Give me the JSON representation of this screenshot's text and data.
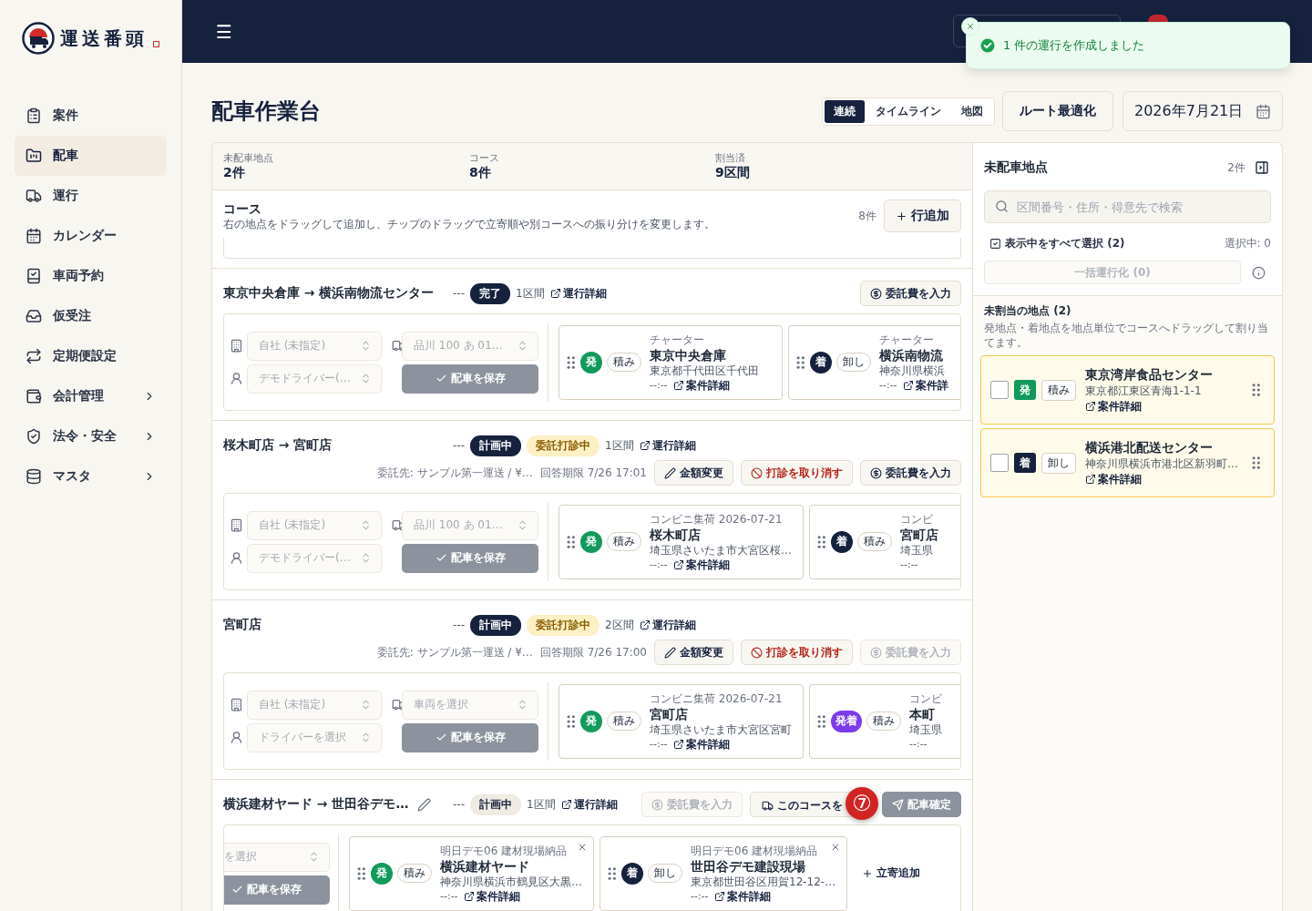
{
  "app": {
    "logo_text": "運送番頭"
  },
  "sidebar": {
    "items": [
      {
        "label": "案件",
        "selected": false,
        "expandable": false
      },
      {
        "label": "配車",
        "selected": true,
        "expandable": false
      },
      {
        "label": "運行",
        "selected": false,
        "expandable": false
      },
      {
        "label": "カレンダー",
        "selected": false,
        "expandable": false
      },
      {
        "label": "車両予約",
        "selected": false,
        "expandable": false
      },
      {
        "label": "仮受注",
        "selected": false,
        "expandable": false
      },
      {
        "label": "定期便設定",
        "selected": false,
        "expandable": false
      },
      {
        "label": "会計管理",
        "selected": false,
        "expandable": true
      },
      {
        "label": "法令・安全",
        "selected": false,
        "expandable": true
      },
      {
        "label": "マスタ",
        "selected": false,
        "expandable": true
      }
    ]
  },
  "header": {
    "menu_glyph": "☰"
  },
  "toast": {
    "message": "1 件の運行を作成しました"
  },
  "page": {
    "title": "配車作業台"
  },
  "view_tabs": [
    {
      "label": "連続",
      "selected": true
    },
    {
      "label": "タイムライン",
      "selected": false
    },
    {
      "label": "地図",
      "selected": false
    }
  ],
  "optimize_button": "ルート最適化",
  "date_field": {
    "value": "2026年7月21日"
  },
  "stats": [
    {
      "label": "未配車地点",
      "value": "2件"
    },
    {
      "label": "コース",
      "value": "8件"
    },
    {
      "label": "割当済",
      "value": "9区間"
    }
  ],
  "courses_section": {
    "title": "コース",
    "description": "右の地点をドラッグして追加し、チップのドラッグで立寄順や別コースへの振り分けを変更します。",
    "count": "8件",
    "add_button": "行追加"
  },
  "courses": [
    {
      "title": "東京中央倉庫 → 横浜南物流センター",
      "editable": false,
      "dash": "---",
      "status": {
        "label": "完了",
        "kind": "solid"
      },
      "segments": "1区間",
      "detail_link": "運行詳細",
      "actions": [
        {
          "label": "委託費を入力",
          "kind": "fee",
          "disabled": false
        }
      ],
      "assign": {
        "scrolled": false,
        "company": "自社 (未指定)",
        "vehicle": "品川 100 あ 01…",
        "driver": "デモドライバー(…",
        "save": "配車を保存"
      },
      "stops": [
        {
          "caption": "チャーター",
          "color": "#119a5b",
          "type_label": "発",
          "work": "積み",
          "name": "東京中央倉庫",
          "address": "東京都千代田区千代田",
          "time": "--:--",
          "link": "案件詳細"
        },
        {
          "caption": "チャーター",
          "color": "#15213d",
          "type_label": "着",
          "work": "卸し",
          "name": "横浜南物流",
          "address": "神奈川県横浜",
          "time": "--:--",
          "link": "案件詳"
        }
      ]
    },
    {
      "title": "桜木町店 → 宮町店",
      "editable": false,
      "dash": "---",
      "status": {
        "label": "計画中",
        "kind": "solid"
      },
      "consult": "委託打診中",
      "segments": "1区間",
      "detail_link": "運行詳細",
      "consignee": "委託先: サンプル第一運送 / ¥…",
      "deadline": "回答期限 7/26 17:01",
      "actions": [
        {
          "label": "金額変更",
          "kind": "amount",
          "disabled": false
        },
        {
          "label": "打診を取り消す",
          "kind": "cancel",
          "disabled": false
        },
        {
          "label": "委託費を入力",
          "kind": "fee",
          "disabled": false
        }
      ],
      "assign": {
        "scrolled": false,
        "company": "自社 (未指定)",
        "vehicle": "品川 100 あ 01…",
        "driver": "デモドライバー(…",
        "save": "配車を保存"
      },
      "stops": [
        {
          "caption": "コンビニ集荷 2026-07-21",
          "color": "#119a5b",
          "type_label": "発",
          "work": "積み",
          "name": "桜木町店",
          "address": "埼玉県さいたま市大宮区桜…",
          "time": "--:--",
          "link": "案件詳細"
        },
        {
          "caption": "コンビ",
          "color": "#15213d",
          "type_label": "着",
          "work": "積み",
          "name": "宮町店",
          "address": "埼玉県",
          "time": "--:--"
        }
      ]
    },
    {
      "title": "宮町店",
      "editable": false,
      "dash": "---",
      "status": {
        "label": "計画中",
        "kind": "solid"
      },
      "consult": "委託打診中",
      "segments": "2区間",
      "detail_link": "運行詳細",
      "consignee": "委託先: サンプル第一運送 / ¥…",
      "deadline": "回答期限 7/26 17:00",
      "actions": [
        {
          "label": "金額変更",
          "kind": "amount",
          "disabled": false
        },
        {
          "label": "打診を取り消す",
          "kind": "cancel",
          "disabled": false
        },
        {
          "label": "委託費を入力",
          "kind": "fee",
          "disabled": true
        }
      ],
      "assign": {
        "scrolled": false,
        "company": "自社 (未指定)",
        "vehicle": "車両を選択",
        "driver": "ドライバーを選択",
        "save": "配車を保存"
      },
      "stops": [
        {
          "caption": "コンビニ集荷 2026-07-21",
          "color": "#119a5b",
          "type_label": "発",
          "work": "積み",
          "name": "宮町店",
          "address": "埼玉県さいたま市大宮区宮町",
          "time": "--:--",
          "link": "案件詳細"
        },
        {
          "caption": "コンビ",
          "color": "#7c3aed",
          "type_label": "発着",
          "work": "積み",
          "name": "本町",
          "address": "埼玉県",
          "time": "--:--"
        }
      ]
    },
    {
      "title": "横浜建材ヤード → 世田谷デモ…",
      "editable": true,
      "dash": "---",
      "status": {
        "label": "計画中",
        "kind": "soft"
      },
      "segments": "1区間",
      "detail_link": "運行詳細",
      "actions": [
        {
          "label": "委託費を入力",
          "kind": "fee",
          "disabled": true
        },
        {
          "label": "このコースを",
          "kind": "course",
          "disabled": false,
          "marker": "⑦"
        },
        {
          "label": "配車確定",
          "kind": "dispatch",
          "disabled": true
        }
      ],
      "assign": {
        "scrolled": true,
        "vehicle": "を選択",
        "save": "配車を保存"
      },
      "stops": [
        {
          "caption": "明日デモ06 建材現場納品",
          "color": "#119a5b",
          "type_label": "発",
          "work": "積み",
          "name": "横浜建材ヤード",
          "address": "神奈川県横浜市鶴見区大黒…",
          "time": "--:--",
          "link": "案件詳細",
          "removable": true
        },
        {
          "caption": "明日デモ06 建材現場納品",
          "color": "#15213d",
          "type_label": "着",
          "work": "卸し",
          "name": "世田谷デモ建設現場",
          "address": "東京都世田谷区用賀12-12-…",
          "time": "--:--",
          "link": "案件詳細",
          "removable": true
        }
      ],
      "add_stop": "立寄追加"
    }
  ],
  "unassigned": {
    "title": "未配車地点",
    "count": "2件",
    "search_placeholder": "区間番号・住所・得意先で検索",
    "select_all": "表示中をすべて選択 (2)",
    "selected_count": "選択中: 0",
    "bulk_button": "一括運行化 (0)",
    "section_title": "未割当の地点 (2)",
    "section_hint": "発地点・着地点を地点単位でコースへドラッグして割り当てます。",
    "items": [
      {
        "checked": false,
        "color": "#119a5b",
        "type_label": "発",
        "work": "積み",
        "name": "東京湾岸食品センター",
        "address": "東京都江東区青海1-1-1",
        "link": "案件詳細"
      },
      {
        "checked": false,
        "color": "#15213d",
        "type_label": "着",
        "work": "卸し",
        "name": "横浜港北配送センター",
        "address": "神奈川県横浜市港北区新羽町…",
        "link": "案件詳細"
      }
    ]
  }
}
